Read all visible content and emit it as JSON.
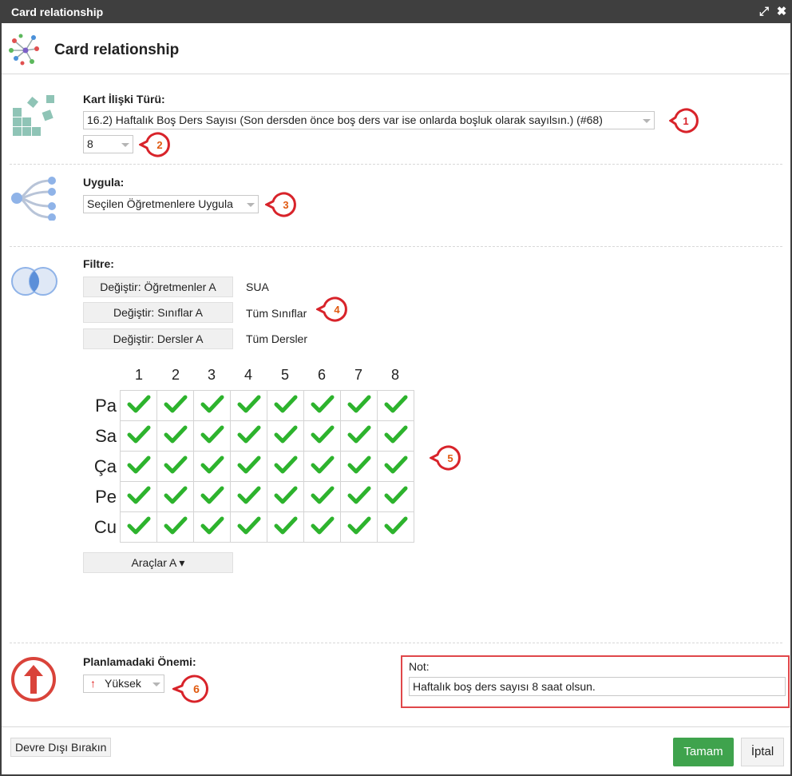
{
  "window": {
    "title": "Card relationship"
  },
  "header": {
    "title": "Card relationship"
  },
  "relation_type": {
    "label": "Kart İlişki Türü:",
    "selected": "16.2) Haftalık Boş Ders Sayısı (Son dersden önce boş ders var ise onlarda boşluk olarak sayılsın.) (#68)",
    "value": "8"
  },
  "apply": {
    "label": "Uygula:",
    "selected": "Seçilen Öğretmenlere Uygula"
  },
  "filter": {
    "label": "Filtre:",
    "rows": [
      {
        "button": "Değiştir: Öğretmenler A",
        "value": "SUA"
      },
      {
        "button": "Değiştir: Sınıflar A",
        "value": "Tüm Sınıflar"
      },
      {
        "button": "Değiştir: Dersler A",
        "value": "Tüm Dersler"
      }
    ]
  },
  "grid": {
    "columns": [
      "1",
      "2",
      "3",
      "4",
      "5",
      "6",
      "7",
      "8"
    ],
    "rows": [
      "Pa",
      "Sa",
      "Ça",
      "Pe",
      "Cu"
    ],
    "all_checked": true
  },
  "tools_button": "Araçlar A ▾",
  "importance": {
    "label": "Planlamadaki Önemi:",
    "selected": "Yüksek"
  },
  "note": {
    "label": "Not:",
    "value": "Haftalık boş ders sayısı 8 saat olsun."
  },
  "footer": {
    "disable": "Devre Dışı Bırakın",
    "ok": "Tamam",
    "cancel": "İptal"
  },
  "badges": [
    "1",
    "2",
    "3",
    "4",
    "5",
    "6"
  ],
  "colors": {
    "accent_green": "#3fa34d",
    "check_green": "#2db32d",
    "badge_red": "#d8232a",
    "note_border": "#e0474a",
    "titlebar": "#3f3f3f"
  }
}
